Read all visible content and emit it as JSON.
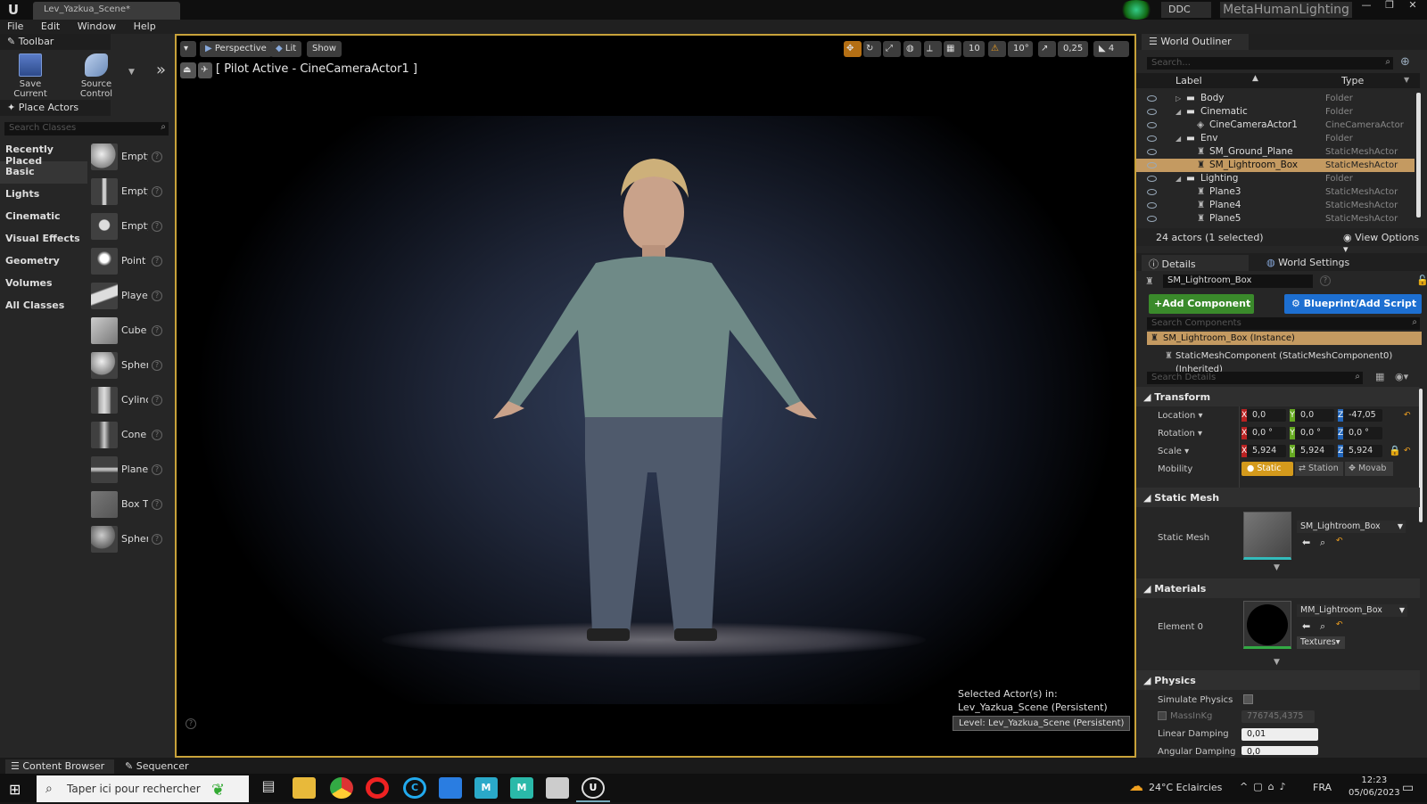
{
  "window": {
    "logo": "U",
    "doc_tab": "Lev_Yazkua_Scene*",
    "ddc_label": "DDC",
    "project_name": "MetaHumanLighting"
  },
  "menu": [
    "File",
    "Edit",
    "Window",
    "Help"
  ],
  "toolbar": {
    "tab_label": "Toolbar",
    "save_label": "Save Current",
    "source_control_label": "Source Control"
  },
  "place_actors": {
    "tab_label": "Place Actors",
    "search_placeholder": "Search Classes",
    "categories": [
      "Recently Placed",
      "Basic",
      "Lights",
      "Cinematic",
      "Visual Effects",
      "Geometry",
      "Volumes",
      "All Classes"
    ],
    "selected_category": "Basic",
    "actors": [
      "Empty",
      "Empty",
      "Empty",
      "Point",
      "Playe",
      "Cube",
      "Spher",
      "Cylinc",
      "Cone",
      "Plane",
      "Box T",
      "Spher"
    ]
  },
  "viewport": {
    "perspective_label": "Perspective",
    "lit_label": "Lit",
    "show_label": "Show",
    "grid_value": "10",
    "rotation_snap": "10°",
    "scale_snap": "0,25",
    "camera_speed": "4",
    "pilot_text": "[ Pilot Active - CineCameraActor1 ]",
    "selected_actors_label": "Selected Actor(s) in:",
    "selected_actors_scene": "Lev_Yazkua_Scene (Persistent)",
    "level_label": "Level:  Lev_Yazkua_Scene (Persistent)"
  },
  "outliner": {
    "tab_label": "World Outliner",
    "search_placeholder": "Search...",
    "col_label": "Label",
    "col_type": "Type",
    "rows": [
      {
        "label": "Body",
        "type": "Folder",
        "indent": 1
      },
      {
        "label": "Cinematic",
        "type": "Folder",
        "indent": 1
      },
      {
        "label": "CineCameraActor1",
        "type": "CineCameraActor",
        "indent": 2
      },
      {
        "label": "Env",
        "type": "Folder",
        "indent": 1
      },
      {
        "label": "SM_Ground_Plane",
        "type": "StaticMeshActor",
        "indent": 2
      },
      {
        "label": "SM_Lightroom_Box",
        "type": "StaticMeshActor",
        "indent": 2
      },
      {
        "label": "Lighting",
        "type": "Folder",
        "indent": 1
      },
      {
        "label": "Plane3",
        "type": "StaticMeshActor",
        "indent": 2
      },
      {
        "label": "Plane4",
        "type": "StaticMeshActor",
        "indent": 2
      },
      {
        "label": "Plane5",
        "type": "StaticMeshActor",
        "indent": 2
      }
    ],
    "selected_row": "SM_Lightroom_Box",
    "actor_count": "24 actors (1 selected)",
    "view_options": "View Options"
  },
  "details": {
    "tab_label": "Details",
    "world_settings_label": "World Settings",
    "actor_name": "SM_Lightroom_Box",
    "add_component": "Add Component",
    "blueprint_script": "Blueprint/Add Script",
    "search_components": "Search Components",
    "instance_label": "SM_Lightroom_Box (Instance)",
    "component_label": "StaticMeshComponent (StaticMeshComponent0) (Inherited)",
    "search_details": "Search Details",
    "transform": {
      "section": "Transform",
      "location_label": "Location",
      "location": [
        "0,0",
        "0,0",
        "-47,05"
      ],
      "rotation_label": "Rotation",
      "rotation": [
        "0,0 °",
        "0,0 °",
        "0,0 °"
      ],
      "scale_label": "Scale",
      "scale": [
        "5,924",
        "5,924",
        "5,924"
      ],
      "mobility_label": "Mobility",
      "mobility_options": [
        "Static",
        "Station",
        "Movab"
      ]
    },
    "static_mesh": {
      "section": "Static Mesh",
      "label": "Static Mesh",
      "value": "SM_Lightroom_Box"
    },
    "materials": {
      "section": "Materials",
      "element_label": "Element 0",
      "value": "MM_Lightroom_Box",
      "textures_label": "Textures"
    },
    "physics": {
      "section": "Physics",
      "simulate_label": "Simulate Physics",
      "mass_label": "MassInKg",
      "mass_value": "776745,4375",
      "linear_damping_label": "Linear Damping",
      "linear_damping_value": "0,01",
      "angular_damping_label": "Angular Damping",
      "angular_damping_value": "0,0"
    }
  },
  "bottom_tabs": [
    "Content Browser",
    "Sequencer"
  ],
  "taskbar": {
    "search_placeholder": "Taper ici pour rechercher",
    "weather": "24°C  Eclaircies",
    "language": "FRA",
    "time": "12:23",
    "date": "05/06/2023"
  },
  "colors": {
    "accent_orange": "#c8a23a",
    "add_component_green": "#3a8a2b",
    "blueprint_blue": "#1d6fd1",
    "selection": "#c49a61"
  }
}
